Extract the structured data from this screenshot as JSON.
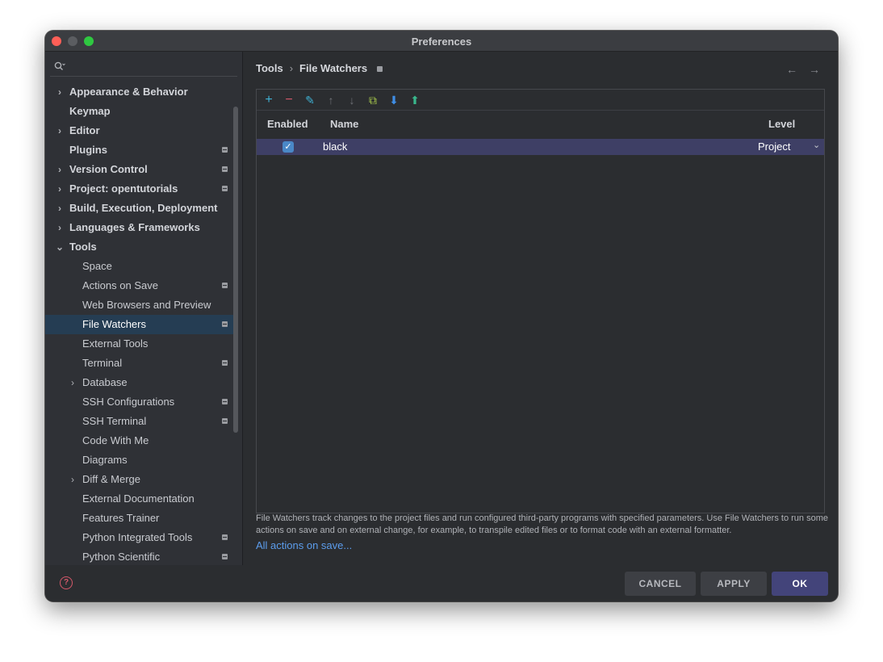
{
  "window": {
    "title": "Preferences"
  },
  "sidebar": {
    "search": {
      "placeholder": ""
    },
    "items": [
      {
        "label": "Appearance & Behavior",
        "level": 0,
        "chevron": "›"
      },
      {
        "label": "Keymap",
        "level": 0
      },
      {
        "label": "Editor",
        "level": 0,
        "chevron": "›"
      },
      {
        "label": "Plugins",
        "level": 0,
        "badge": true
      },
      {
        "label": "Version Control",
        "level": 0,
        "chevron": "›",
        "badge": true
      },
      {
        "label": "Project: opentutorials",
        "level": 0,
        "chevron": "›",
        "badge": true
      },
      {
        "label": "Build, Execution, Deployment",
        "level": 0,
        "chevron": "›"
      },
      {
        "label": "Languages & Frameworks",
        "level": 0,
        "chevron": "›"
      },
      {
        "label": "Tools",
        "level": 0,
        "chevron": "⌄"
      },
      {
        "label": "Space",
        "level": 1
      },
      {
        "label": "Actions on Save",
        "level": 1,
        "badge": true
      },
      {
        "label": "Web Browsers and Preview",
        "level": 1
      },
      {
        "label": "File Watchers",
        "level": 1,
        "badge": true,
        "selected": true
      },
      {
        "label": "External Tools",
        "level": 1
      },
      {
        "label": "Terminal",
        "level": 1,
        "badge": true
      },
      {
        "label": "Database",
        "level": 1,
        "chevron": "›"
      },
      {
        "label": "SSH Configurations",
        "level": 1,
        "badge": true
      },
      {
        "label": "SSH Terminal",
        "level": 1,
        "badge": true
      },
      {
        "label": "Code With Me",
        "level": 1
      },
      {
        "label": "Diagrams",
        "level": 1
      },
      {
        "label": "Diff & Merge",
        "level": 1,
        "chevron": "›"
      },
      {
        "label": "External Documentation",
        "level": 1
      },
      {
        "label": "Features Trainer",
        "level": 1
      },
      {
        "label": "Python Integrated Tools",
        "level": 1,
        "badge": true
      },
      {
        "label": "Python Scientific",
        "level": 1,
        "badge": true
      }
    ]
  },
  "breadcrumb": {
    "parent": "Tools",
    "separator": "›",
    "current": "File Watchers"
  },
  "toolbar": {
    "add": "+",
    "remove": "−",
    "edit": "✎",
    "up": "↑",
    "down": "↓",
    "copy": "⧉",
    "import": "⬇",
    "export": "⬆"
  },
  "table": {
    "headers": {
      "enabled": "Enabled",
      "name": "Name",
      "level": "Level"
    },
    "rows": [
      {
        "enabled": true,
        "name": "black",
        "level": "Project"
      }
    ]
  },
  "hint": "File Watchers track changes to the project files and run configured third-party programs with specified parameters. Use File Watchers to run some actions on save and on external change, for example, to transpile edited files or to format code with an external formatter.",
  "link": "All actions on save...",
  "footer": {
    "cancel": "CANCEL",
    "apply": "APPLY",
    "ok": "OK",
    "help": "?"
  },
  "colors": {
    "accent": "#43447a",
    "selection": "#253d53",
    "row_selected": "#3e3f65",
    "link": "#5c9ded"
  }
}
